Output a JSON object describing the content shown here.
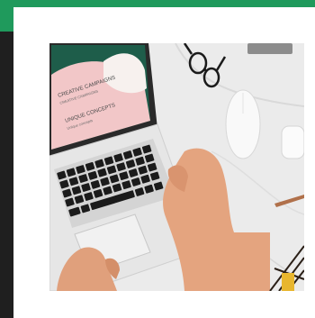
{
  "header": {
    "accent_color": "#1f9a5c"
  },
  "sidebar": {
    "color": "#1f1f1f"
  },
  "photo": {
    "subject": "laptop-on-marble-desk-photo",
    "screen_text": {
      "line1": "CREATIVE CAMPAIGNS",
      "line2": "CREATIVE CAMPAIGNS",
      "line3": "UNIQUE CONCEPTS",
      "line4": "Unique concepts"
    }
  }
}
